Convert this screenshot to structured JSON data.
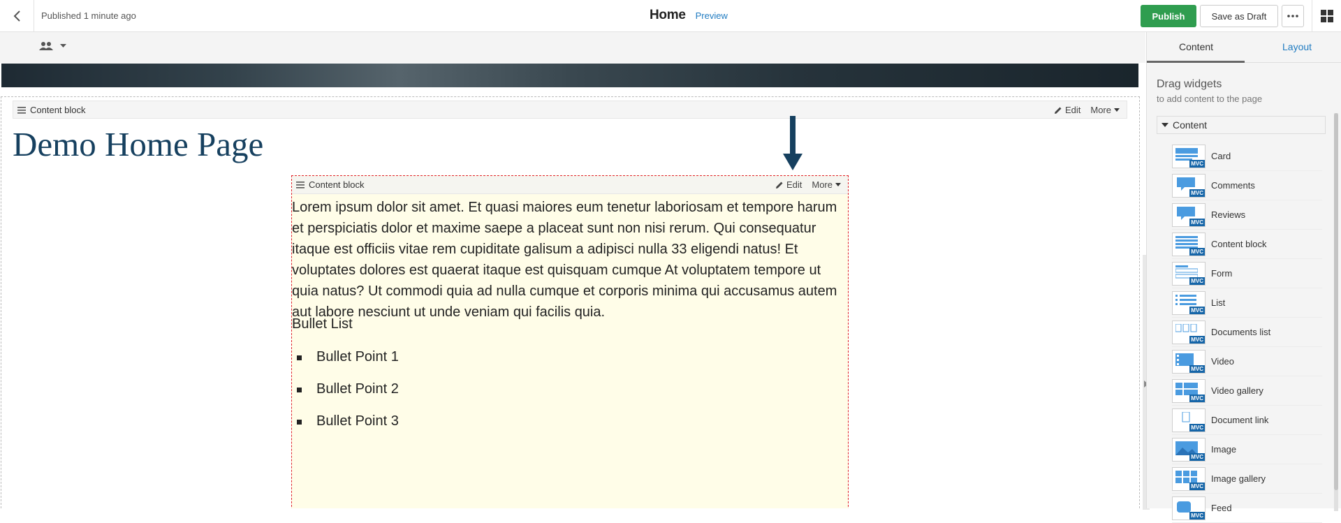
{
  "topbar": {
    "status": "Published 1 minute ago",
    "title": "Home",
    "preview": "Preview",
    "publish": "Publish",
    "save_draft": "Save as Draft"
  },
  "canvas": {
    "outer_block": {
      "label": "Content block",
      "edit": "Edit",
      "more": "More"
    },
    "heading": "Demo Home Page",
    "inner_block": {
      "label": "Content block",
      "edit": "Edit",
      "more": "More",
      "lorem": "Lorem ipsum dolor sit amet. Et quasi maiores eum tenetur laboriosam et tempore harum et perspiciatis dolor et maxime saepe a placeat sunt non nisi rerum. Qui consequatur itaque est officiis vitae rem cupiditate galisum a adipisci nulla 33 eligendi natus! Et voluptates dolores est quaerat itaque est quisquam cumque At voluptatem tempore ut quia natus? Ut commodi quia ad nulla cumque et corporis minima qui accusamus autem aut labore nesciunt ut unde veniam qui facilis quia.",
      "bullet_title": "Bullet List",
      "bullets": [
        "Bullet Point 1",
        "Bullet Point 2",
        "Bullet Point 3"
      ]
    }
  },
  "panel": {
    "tabs": [
      "Content",
      "Layout"
    ],
    "drag_title": "Drag widgets",
    "drag_sub": "to add content to the page",
    "group": "Content",
    "badge": "MVC",
    "widgets": [
      {
        "label": "Card",
        "icon": "card-icon"
      },
      {
        "label": "Comments",
        "icon": "comments-icon"
      },
      {
        "label": "Reviews",
        "icon": "reviews-icon"
      },
      {
        "label": "Content block",
        "icon": "content-block-icon"
      },
      {
        "label": "Form",
        "icon": "form-icon"
      },
      {
        "label": "List",
        "icon": "list-icon"
      },
      {
        "label": "Documents list",
        "icon": "documents-list-icon"
      },
      {
        "label": "Video",
        "icon": "video-icon"
      },
      {
        "label": "Video gallery",
        "icon": "video-gallery-icon"
      },
      {
        "label": "Document link",
        "icon": "document-link-icon"
      },
      {
        "label": "Image",
        "icon": "image-icon"
      },
      {
        "label": "Image gallery",
        "icon": "image-gallery-icon"
      },
      {
        "label": "Feed",
        "icon": "feed-icon"
      }
    ]
  },
  "colors": {
    "accent": "#1f7bc1",
    "publish": "#2f9d4f",
    "heading": "#16405f",
    "highlight_bg": "#fffde8",
    "selection_border": "#e0202a",
    "mvc_badge": "#1565a8"
  }
}
